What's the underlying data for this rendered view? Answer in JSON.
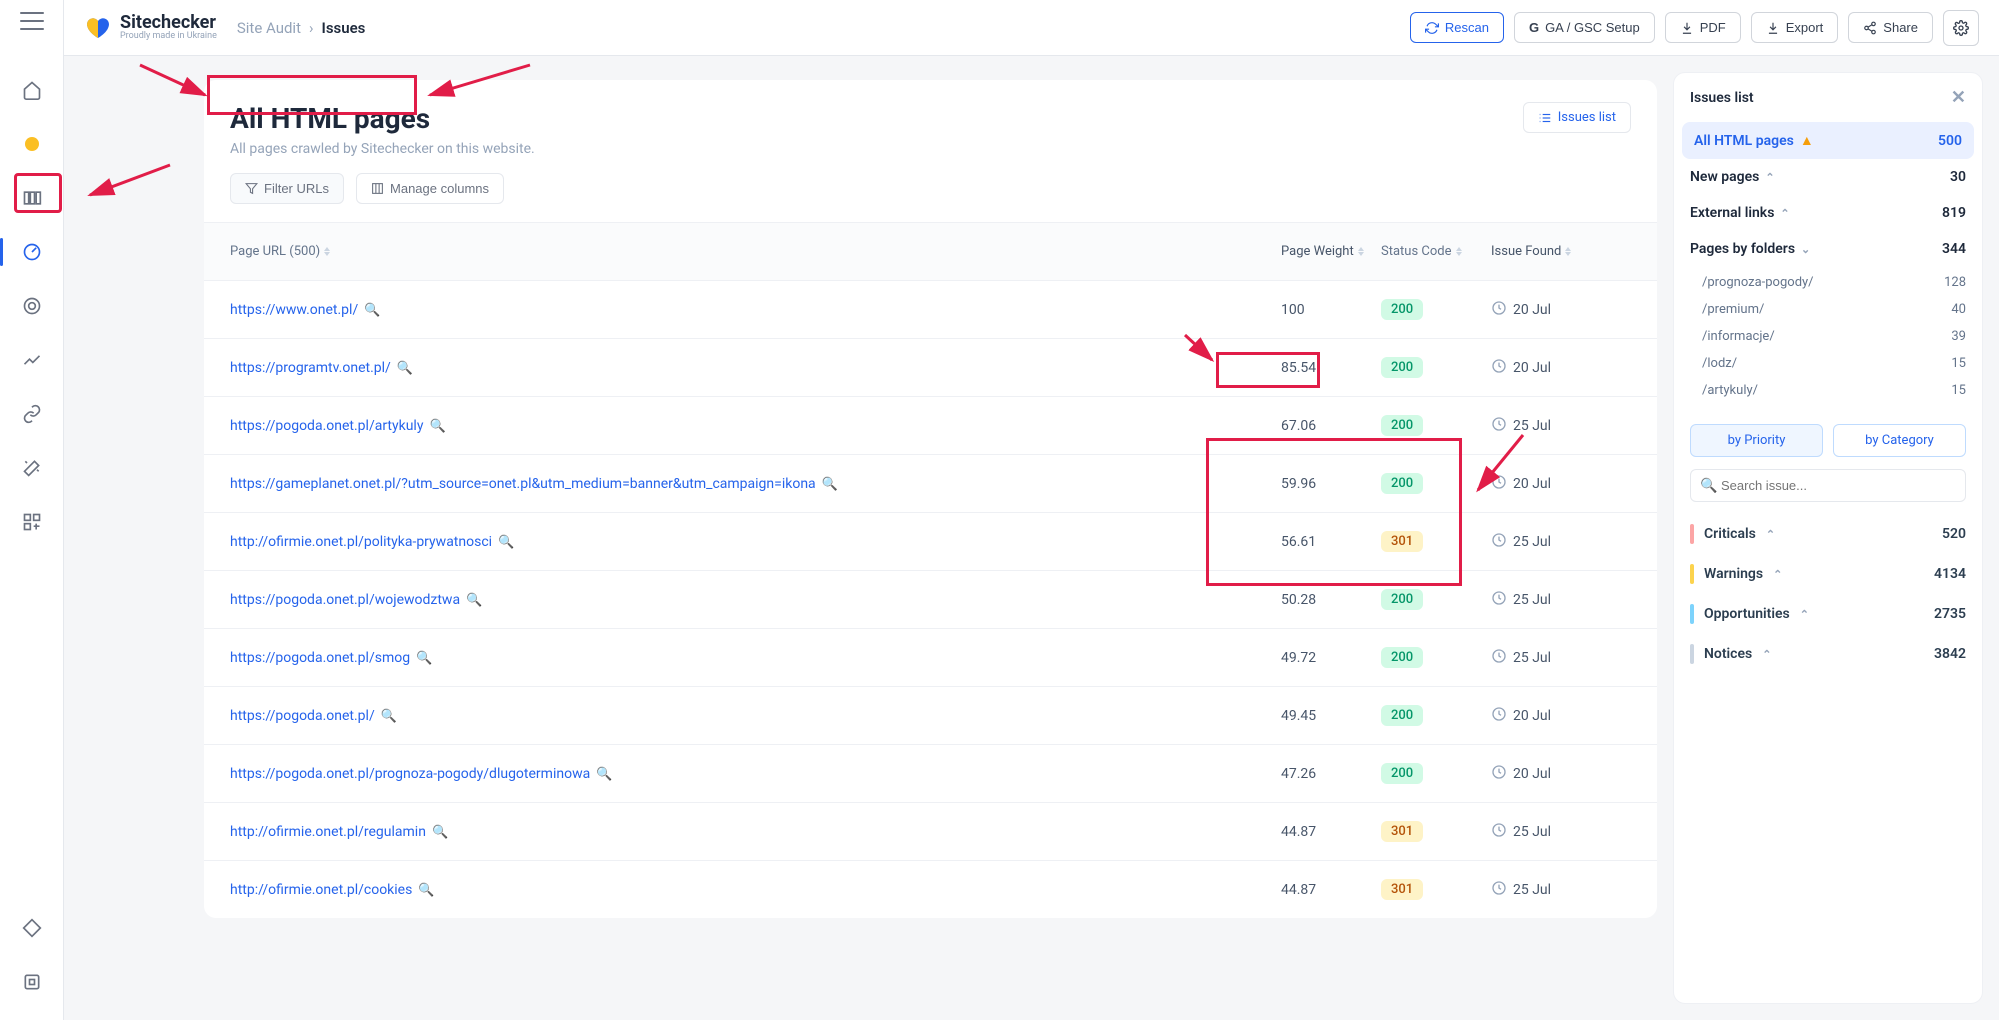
{
  "brand": {
    "name": "Sitechecker",
    "tagline": "Proudly made in Ukraine"
  },
  "breadcrumb": {
    "parent": "Site Audit",
    "sep": "›",
    "current": "Issues"
  },
  "header_actions": {
    "rescan": "Rescan",
    "ga": "GA / GSC Setup",
    "pdf": "PDF",
    "export": "Export",
    "share": "Share"
  },
  "page": {
    "title": "All HTML pages",
    "subtitle": "All pages crawled by Sitechecker on this website.",
    "issues_list_btn": "Issues list"
  },
  "filters": {
    "filter_urls": "Filter URLs",
    "manage_cols": "Manage columns"
  },
  "table": {
    "head": {
      "url": "Page URL (500)",
      "weight": "Page Weight",
      "status": "Status Code",
      "issue": "Issue Found"
    },
    "rows": [
      {
        "url": "https://www.onet.pl/",
        "weight": "100",
        "status": "200",
        "date": "20 Jul"
      },
      {
        "url": "https://programtv.onet.pl/",
        "weight": "85.54",
        "status": "200",
        "date": "20 Jul"
      },
      {
        "url": "https://pogoda.onet.pl/artykuly",
        "weight": "67.06",
        "status": "200",
        "date": "25 Jul"
      },
      {
        "url": "https://gameplanet.onet.pl/?utm_source=onet.pl&utm_medium=banner&utm_campaign=ikona",
        "weight": "59.96",
        "status": "200",
        "date": "20 Jul"
      },
      {
        "url": "http://ofirmie.onet.pl/polityka-prywatnosci",
        "weight": "56.61",
        "status": "301",
        "date": "25 Jul"
      },
      {
        "url": "https://pogoda.onet.pl/wojewodztwa",
        "weight": "50.28",
        "status": "200",
        "date": "25 Jul"
      },
      {
        "url": "https://pogoda.onet.pl/smog",
        "weight": "49.72",
        "status": "200",
        "date": "25 Jul"
      },
      {
        "url": "https://pogoda.onet.pl/",
        "weight": "49.45",
        "status": "200",
        "date": "20 Jul"
      },
      {
        "url": "https://pogoda.onet.pl/prognoza-pogody/dlugoterminowa",
        "weight": "47.26",
        "status": "200",
        "date": "20 Jul"
      },
      {
        "url": "http://ofirmie.onet.pl/regulamin",
        "weight": "44.87",
        "status": "301",
        "date": "25 Jul"
      },
      {
        "url": "http://ofirmie.onet.pl/cookies",
        "weight": "44.87",
        "status": "301",
        "date": "25 Jul"
      }
    ]
  },
  "panel": {
    "title": "Issues list",
    "items": {
      "all_html": {
        "label": "All HTML pages",
        "count": "500"
      },
      "new_pages": {
        "label": "New pages",
        "count": "30"
      },
      "external": {
        "label": "External links",
        "count": "819"
      },
      "folders": {
        "label": "Pages by folders",
        "count": "344"
      }
    },
    "folders_list": [
      {
        "name": "/prognoza-pogody/",
        "count": "128"
      },
      {
        "name": "/premium/",
        "count": "40"
      },
      {
        "name": "/informacje/",
        "count": "39"
      },
      {
        "name": "/lodz/",
        "count": "15"
      },
      {
        "name": "/artykuly/",
        "count": "15"
      }
    ],
    "tabs": {
      "priority": "by Priority",
      "category": "by Category"
    },
    "search_placeholder": "Search issue...",
    "priority": [
      {
        "label": "Criticals",
        "count": "520",
        "cls": "red"
      },
      {
        "label": "Warnings",
        "count": "4134",
        "cls": "orange"
      },
      {
        "label": "Opportunities",
        "count": "2735",
        "cls": "blue"
      },
      {
        "label": "Notices",
        "count": "3842",
        "cls": "gray"
      }
    ]
  }
}
